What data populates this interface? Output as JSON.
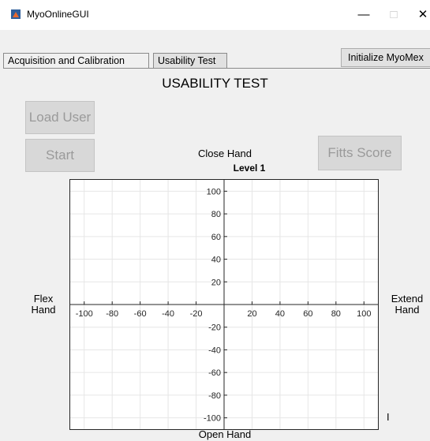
{
  "window": {
    "title": "MyoOnlineGUI",
    "minimize_glyph": "—",
    "maximize_glyph": "□",
    "close_glyph": "✕"
  },
  "tabs": [
    {
      "label": "Acquisition and Calibration",
      "active": false
    },
    {
      "label": "Usability Test",
      "active": true
    }
  ],
  "toolbar": {
    "initialize_label": "Initialize MyoMex"
  },
  "page": {
    "heading": "USABILITY TEST"
  },
  "buttons": {
    "load_user": "Load User",
    "start": "Start",
    "fitts_score": "Fitts Score"
  },
  "direction_labels": {
    "top": "Close Hand",
    "bottom": "Open Hand",
    "left_line1": "Flex",
    "left_line2": "Hand",
    "right_line1": "Extend",
    "right_line2": "Hand"
  },
  "cursor_glyph": "I",
  "colors": {
    "disabled_button_bg": "#d8d8d8",
    "disabled_text": "#9a9a9a",
    "plot_bg": "#ffffff",
    "axis": "#262626"
  },
  "chart_data": {
    "type": "scatter",
    "title": "Level 1",
    "xlabel": "",
    "ylabel": "",
    "xlim": [
      -110,
      110
    ],
    "ylim": [
      -110,
      110
    ],
    "x_ticks": [
      -100,
      -80,
      -60,
      -40,
      -20,
      20,
      40,
      60,
      80,
      100
    ],
    "y_ticks": [
      100,
      80,
      60,
      40,
      20,
      -20,
      -40,
      -60,
      -80,
      -100
    ],
    "grid": true,
    "axis_location": "origin",
    "series": []
  }
}
